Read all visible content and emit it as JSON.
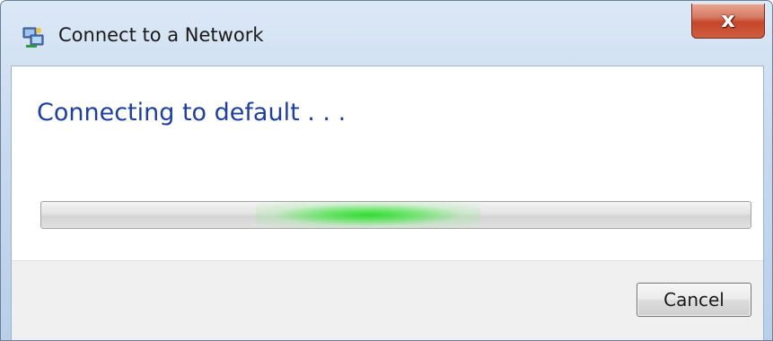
{
  "window": {
    "title": "Connect to a Network",
    "icon": "network-icon",
    "close_label": "x"
  },
  "main": {
    "heading": "Connecting to default . . .",
    "progress": {
      "mode": "indeterminate",
      "glow_position_fraction": 0.36,
      "glow_color": "#22d322"
    }
  },
  "footer": {
    "cancel_label": "Cancel"
  },
  "colors": {
    "heading": "#1f3f9f",
    "close_button": "#c5462b",
    "frame": "#c6d9ef"
  }
}
